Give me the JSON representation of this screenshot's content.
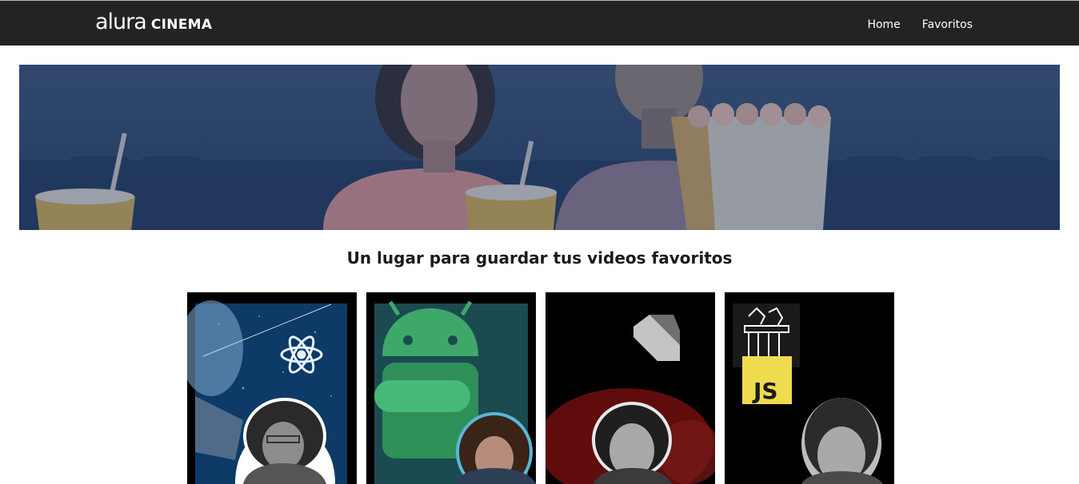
{
  "header": {
    "logo_primary": "alura",
    "logo_secondary": "CINEMA",
    "nav": [
      {
        "label": "Home"
      },
      {
        "label": "Favoritos"
      }
    ]
  },
  "hero": {
    "tagline": "Un lugar para guardar tus videos favoritos"
  },
  "videos": [
    {
      "topic": "React",
      "badge": ""
    },
    {
      "topic": "Android",
      "badge": ""
    },
    {
      "topic": "Dart",
      "badge": ""
    },
    {
      "topic": "JavaScript",
      "badge": "JS"
    }
  ],
  "colors": {
    "header_bg": "#232323",
    "banner_tint": "#2b4670",
    "js_yellow": "#f0db4f"
  }
}
